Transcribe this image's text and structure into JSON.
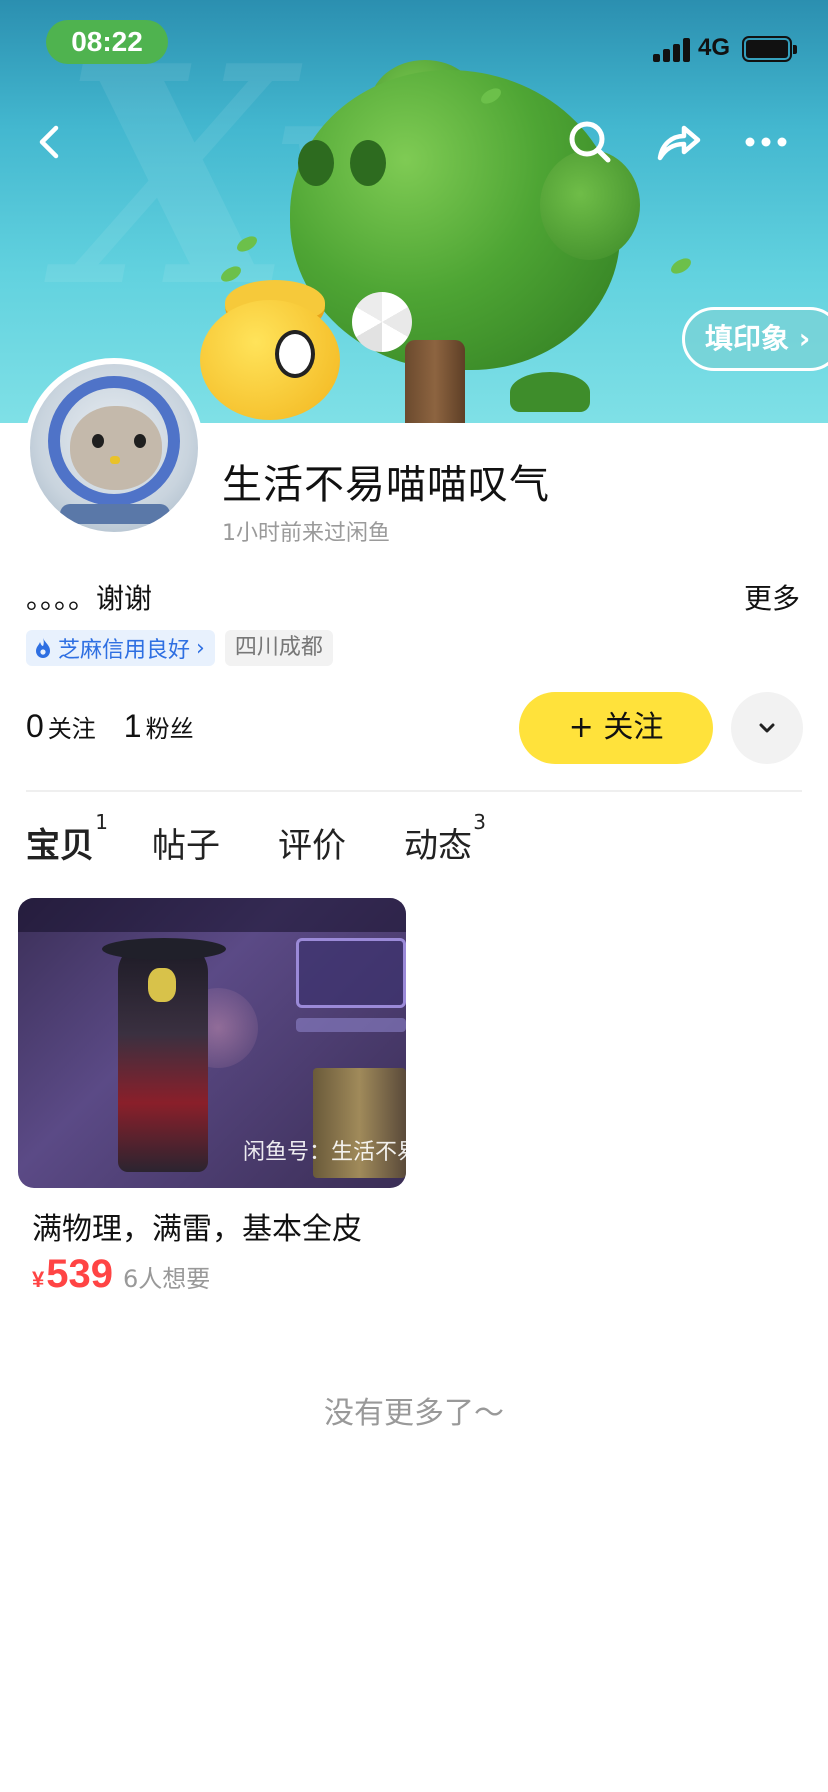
{
  "status_bar": {
    "time": "08:22",
    "network": "4G"
  },
  "header": {
    "imprint_label": "填印象"
  },
  "profile": {
    "username": "生活不易喵喵叹气",
    "last_seen": "1小时前来过闲鱼",
    "bio": "。。。。谢谢",
    "more_label": "更多",
    "credit_tag": "芝麻信用良好",
    "location_tag": "四川成都",
    "following_count": "0",
    "following_label": "关注",
    "followers_count": "1",
    "followers_label": "粉丝",
    "follow_button": "+ 关注"
  },
  "tabs": [
    {
      "label": "宝贝",
      "badge": "1",
      "active": true
    },
    {
      "label": "帖子",
      "badge": "",
      "active": false
    },
    {
      "label": "评价",
      "badge": "",
      "active": false
    },
    {
      "label": "动态",
      "badge": "3",
      "active": false
    }
  ],
  "items": [
    {
      "title": "满物理，满雷，基本全皮",
      "currency": "¥",
      "price": "539",
      "wants": "6人想要",
      "image_watermark": "闲鱼号：生活不易"
    }
  ],
  "footer": {
    "no_more": "没有更多了～"
  },
  "colors": {
    "accent_yellow": "#ffe23b",
    "price_red": "#ff4444",
    "credit_blue": "#2e6fe2"
  }
}
